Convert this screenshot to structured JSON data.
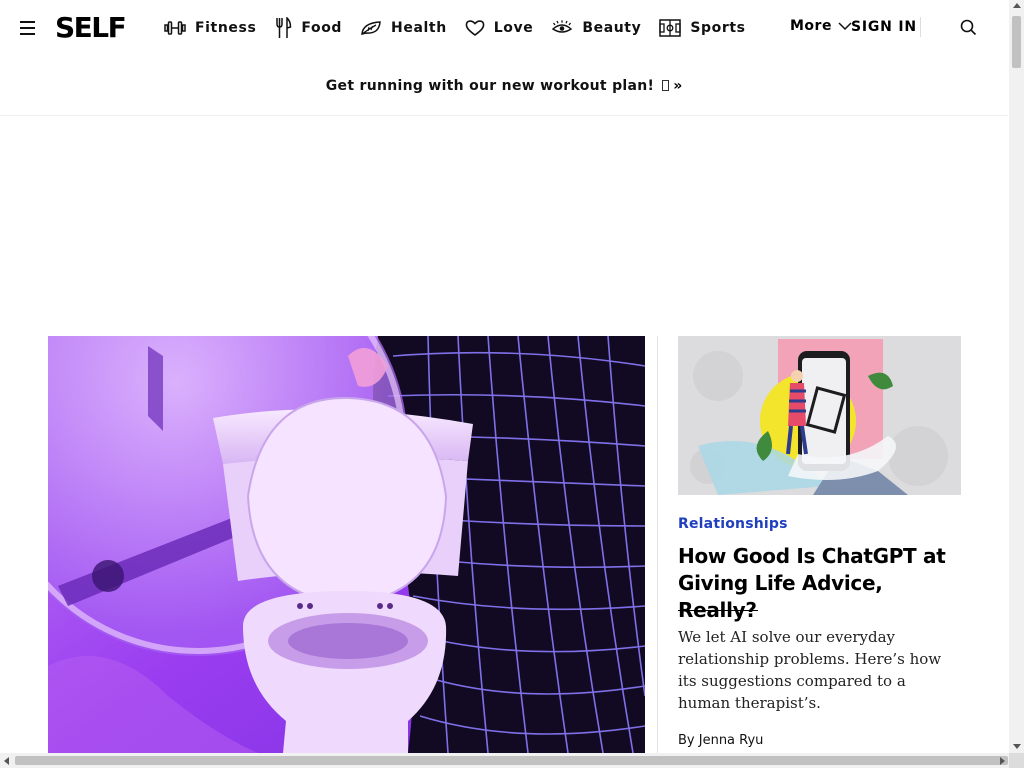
{
  "header": {
    "logo": "SELF",
    "nav": [
      {
        "label": "Fitness",
        "icon": "dumbbell-icon"
      },
      {
        "label": "Food",
        "icon": "fork-knife-icon"
      },
      {
        "label": "Health",
        "icon": "leaf-icon"
      },
      {
        "label": "Love",
        "icon": "heart-icon"
      },
      {
        "label": "Beauty",
        "icon": "eye-lash-icon"
      },
      {
        "label": "Sports",
        "icon": "field-icon"
      }
    ],
    "more_label": "More",
    "signin_label": "SIGN IN"
  },
  "promo": {
    "text": "Get running with our new workout plan!",
    "suffix": "»"
  },
  "side_article": {
    "category": "Relationships",
    "title": "How Good Is ChatGPT at Giving Life Advice, Really?",
    "dek": "We let AI solve our everyday relationship problems. Here’s how its suggestions compared to a human therapist’s.",
    "byline": "By Jenna Ryu"
  },
  "colors": {
    "category_link": "#1f3fbf",
    "hero_purple": "#9a3df0"
  }
}
